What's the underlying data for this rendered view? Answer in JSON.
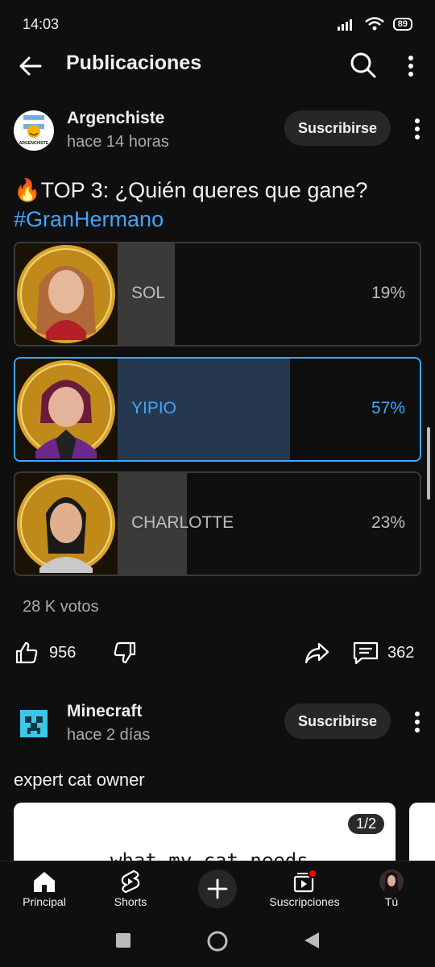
{
  "status": {
    "time": "14:03",
    "battery": "89"
  },
  "header": {
    "title": "Publicaciones"
  },
  "post1": {
    "channel": "Argenchiste",
    "avatar_text": "ARGENCHISTE",
    "time": "hace 14 horas",
    "subscribe": "Suscribirse",
    "text_emoji": "🔥",
    "text": "TOP 3: ¿Quién queres que gane?",
    "hashtag": "#GranHermano",
    "options": [
      {
        "label": "SOL",
        "percent": "19%",
        "value": 19,
        "selected": false
      },
      {
        "label": "YIPIO",
        "percent": "57%",
        "value": 57,
        "selected": true
      },
      {
        "label": "CHARLOTTE",
        "percent": "23%",
        "value": 23,
        "selected": false
      }
    ],
    "votes": "28 K votos",
    "likes": "956",
    "comments": "362"
  },
  "post2": {
    "channel": "Minecraft",
    "time": "hace 2 días",
    "subscribe": "Suscribirse",
    "text": "expert cat owner",
    "page_badge": "1/2",
    "card_text": "what my cat needs"
  },
  "nav": {
    "home": "Principal",
    "shorts": "Shorts",
    "subscriptions": "Suscripciones",
    "you": "Tú"
  },
  "colors": {
    "accent": "#3ea6ff",
    "background": "#0f0f0f",
    "notification": "#ff0000"
  }
}
